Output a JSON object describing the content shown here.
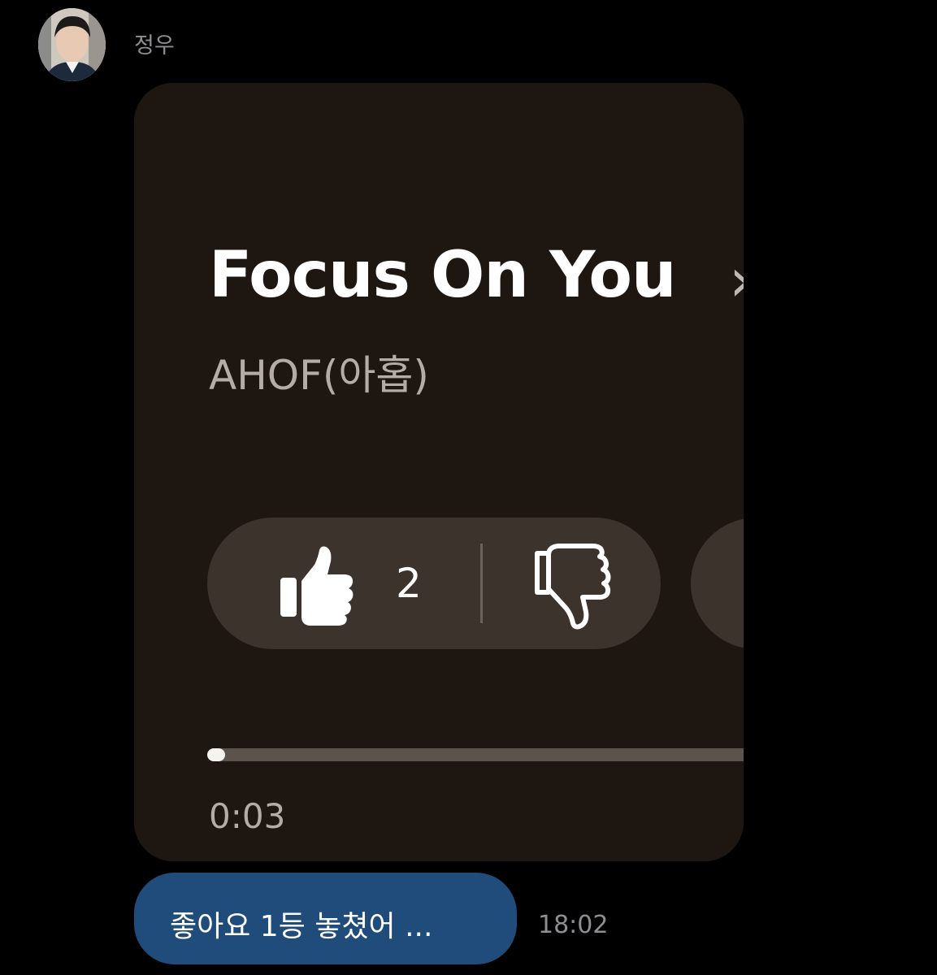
{
  "sender": {
    "name": "정우"
  },
  "player": {
    "song_title": "Focus On You",
    "chevron_glyph": "›",
    "artist": "AHOF(아홉)",
    "like_count": "2",
    "progress_fraction": 0.03,
    "elapsed_time": "0:03"
  },
  "message": {
    "text": "좋아요 1등 놓쳤어 ...",
    "time": "18:02"
  },
  "colors": {
    "background": "#000000",
    "card": "#1e1711",
    "pill": "#3b332c",
    "bubble": "#1f4c7a",
    "muted_text": "#8e8e93"
  },
  "icons": [
    "avatar-photo",
    "thumbs-up-icon",
    "thumbs-down-icon",
    "chevron-right-icon"
  ]
}
